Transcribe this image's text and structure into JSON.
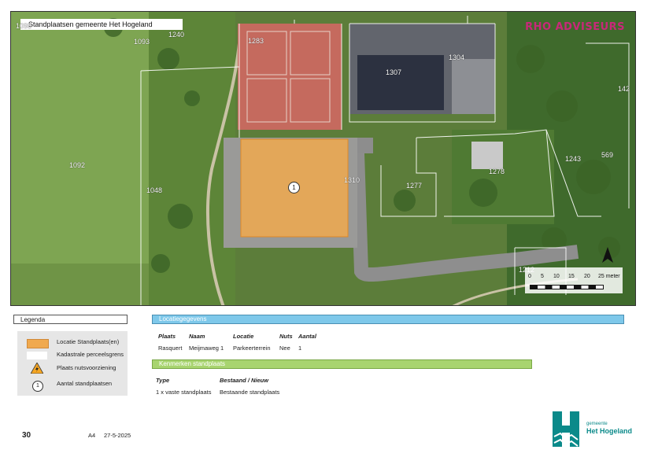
{
  "map": {
    "title": "Standplaatsen gemeente Het Hogeland",
    "brand": "RHO ADVISEURS",
    "parcels": [
      "1283",
      "1304",
      "1307",
      "1092",
      "1048",
      "1310",
      "1277",
      "1278",
      "1243",
      "569",
      "142",
      "1212",
      "1093",
      "1240",
      "1098"
    ],
    "marker_count": "1",
    "scale_ticks": [
      "0",
      "5",
      "10",
      "15",
      "20",
      "25 meter"
    ],
    "north_icon": "north-arrow-icon"
  },
  "legend": {
    "heading": "Legenda",
    "items": [
      {
        "label": "Locatie Standplaats(en)",
        "icon": "orange-fill-swatch",
        "color": "#f0a94e"
      },
      {
        "label": "Kadastrale perceelsgrens",
        "icon": "white-line-swatch",
        "color": "#ffffff"
      },
      {
        "label": "Plaats nutsvoorziening",
        "icon": "electric-warning-icon",
        "color": "#f5a623"
      },
      {
        "label": "Aantal standplaatsen",
        "icon": "number-circle-icon",
        "value": "1"
      }
    ]
  },
  "locatie": {
    "heading": "Locatiegegevens",
    "headers": [
      "Plaats",
      "Naam",
      "Locatie",
      "Nuts",
      "Aantal"
    ],
    "row": [
      "Rasquert",
      "Meijmaweg 1",
      "Parkeerterrein",
      "Nee",
      "1"
    ]
  },
  "kenmerken": {
    "heading": "Kenmerken standplaats",
    "headers": [
      "Type",
      "Bestaand / Nieuw"
    ],
    "row": [
      "1 x vaste standplaats",
      "Bestaande standplaats"
    ]
  },
  "footer": {
    "page": "30",
    "format": "A4",
    "date": "27-5-2025",
    "logo_small": "gemeente",
    "logo_big": "Het Hogeland"
  },
  "colors": {
    "location_fill": "#f0a94e",
    "legend_header": "#7ec8ea",
    "kenmerken_header": "#a8d46f",
    "brand": "#c8287a"
  }
}
